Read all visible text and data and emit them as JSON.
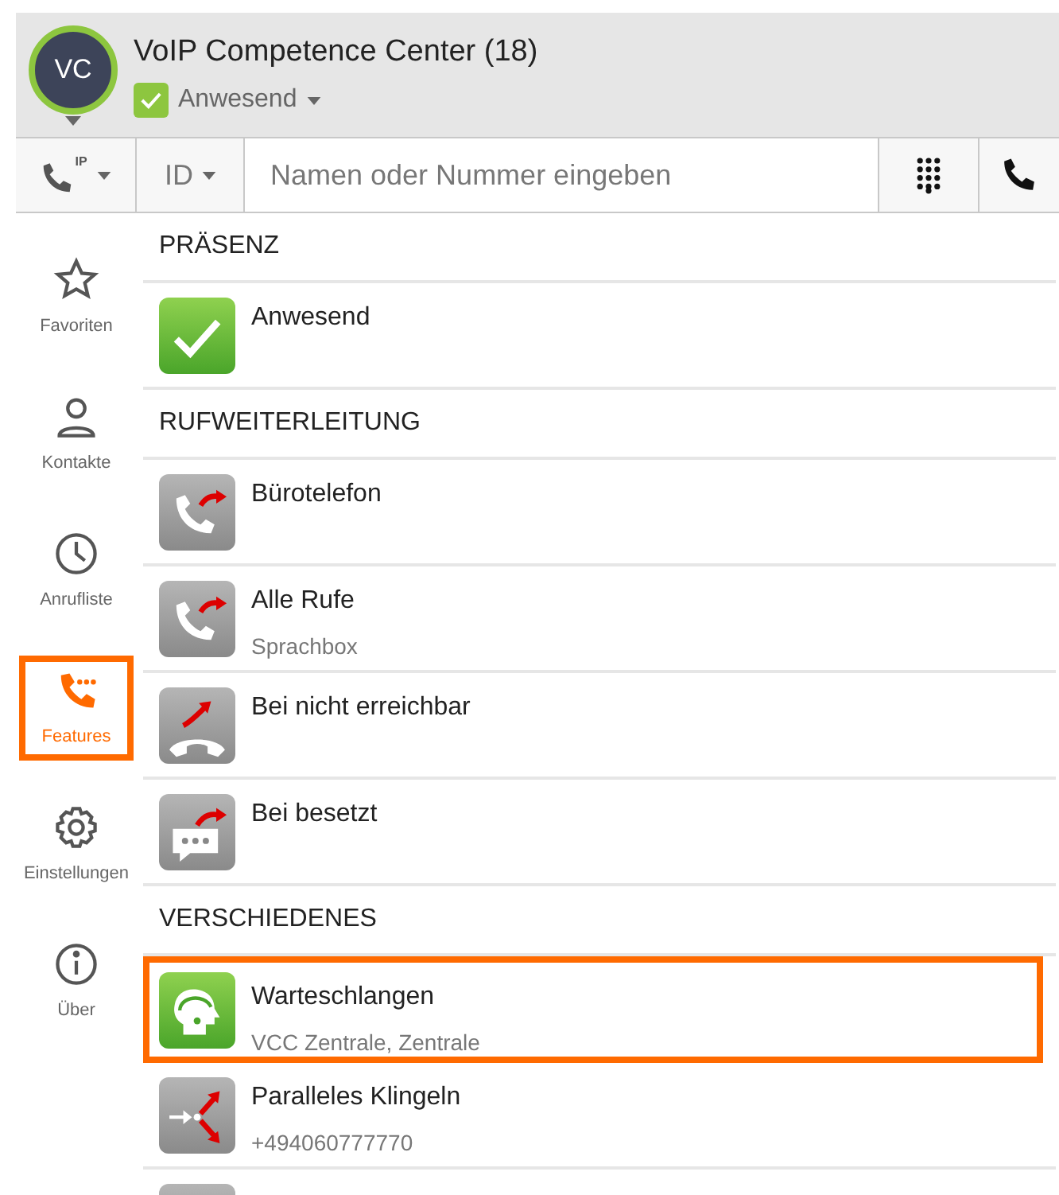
{
  "header": {
    "avatar": "VC",
    "title": "VoIP Competence Center (18)",
    "status": {
      "label": "Anwesend",
      "checked": true
    }
  },
  "toolbar": {
    "line_badge": "IP",
    "id_label": "ID",
    "search": {
      "placeholder": "Namen oder Nummer eingeben"
    }
  },
  "sidebar": {
    "items": [
      {
        "label": "Favoriten",
        "selected": false
      },
      {
        "label": "Kontakte",
        "selected": false
      },
      {
        "label": "Anrufliste",
        "selected": false
      },
      {
        "label": "Features",
        "selected": true
      },
      {
        "label": "Einstellungen",
        "selected": false
      },
      {
        "label": "Über",
        "selected": false
      }
    ]
  },
  "sections": [
    {
      "title": "PRÄSENZ",
      "items": [
        {
          "kind": "check",
          "label": "Anwesend",
          "selected": false
        }
      ]
    },
    {
      "title": "RUFWEITERLEITUNG",
      "items": [
        {
          "kind": "forward",
          "label": "Bürotelefon",
          "selected": false
        },
        {
          "kind": "forward",
          "label": "Alle Rufe",
          "sublabel": "Sprachbox",
          "selected": false
        },
        {
          "kind": "unreachable",
          "label": "Bei nicht erreichbar",
          "selected": false
        },
        {
          "kind": "busy",
          "label": "Bei besetzt",
          "selected": false
        }
      ]
    },
    {
      "title": "VERSCHIEDENES",
      "items": [
        {
          "kind": "queue",
          "label": "Warteschlangen",
          "sublabel": "VCC Zentrale, Zentrale",
          "selected": true
        },
        {
          "kind": "parallel",
          "label": "Paralleles Klingeln",
          "sublabel": "+494060777770",
          "selected": false
        },
        {
          "kind": "blank",
          "selected": false
        }
      ]
    }
  ]
}
